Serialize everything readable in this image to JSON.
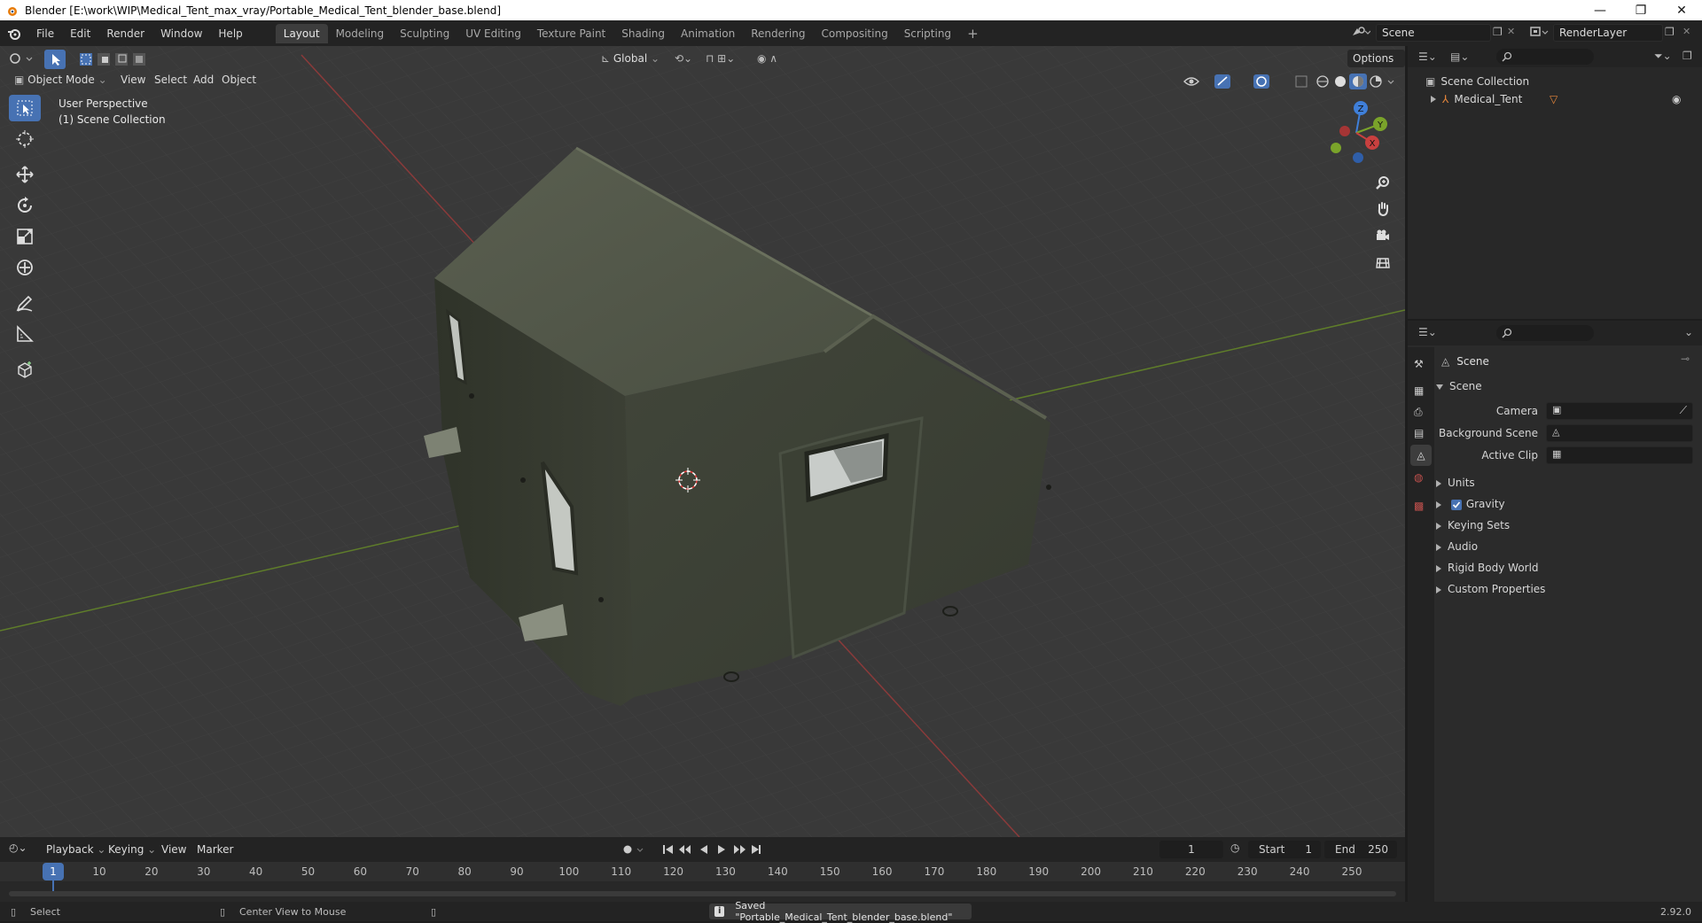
{
  "window": {
    "title": "Blender [E:\\work\\WIP\\Medical_Tent_max_vray/Portable_Medical_Tent_blender_base.blend]",
    "minimize": "—",
    "restore": "❐",
    "close": "✕"
  },
  "menu": {
    "items": [
      "File",
      "Edit",
      "Render",
      "Window",
      "Help"
    ],
    "workspaces": [
      "Layout",
      "Modeling",
      "Sculpting",
      "UV Editing",
      "Texture Paint",
      "Shading",
      "Animation",
      "Rendering",
      "Compositing",
      "Scripting"
    ],
    "active_workspace": "Layout",
    "add_tab": "+",
    "scene_name": "Scene",
    "view_layer": "RenderLayer"
  },
  "viewport": {
    "mode": "Object Mode",
    "menus": [
      "View",
      "Select",
      "Add",
      "Object"
    ],
    "transform_orientation": "Global",
    "options_label": "Options",
    "perspective_label": "User Perspective",
    "collection_label": "(1) Scene Collection",
    "gizmo_axes": [
      "Z",
      "Y",
      "X"
    ]
  },
  "outliner": {
    "root": "Scene Collection",
    "items": [
      {
        "name": "Medical_Tent"
      }
    ]
  },
  "properties": {
    "context_title": "Scene",
    "section_title": "Scene",
    "fields": [
      {
        "label": "Camera",
        "value": ""
      },
      {
        "label": "Background Scene",
        "value": ""
      },
      {
        "label": "Active Clip",
        "value": ""
      }
    ],
    "panels": [
      {
        "label": "Units",
        "checkbox": false
      },
      {
        "label": "Gravity",
        "checkbox": true,
        "checked": true
      },
      {
        "label": "Keying Sets",
        "checkbox": false
      },
      {
        "label": "Audio",
        "checkbox": false
      },
      {
        "label": "Rigid Body World",
        "checkbox": false
      },
      {
        "label": "Custom Properties",
        "checkbox": false
      }
    ]
  },
  "timeline": {
    "menus": [
      "Playback",
      "Keying",
      "View",
      "Marker"
    ],
    "current_frame": "1",
    "start_label": "Start",
    "start_value": "1",
    "end_label": "End",
    "end_value": "250",
    "ticks": [
      "1",
      "10",
      "20",
      "30",
      "40",
      "50",
      "60",
      "70",
      "80",
      "90",
      "100",
      "110",
      "120",
      "130",
      "140",
      "150",
      "160",
      "170",
      "180",
      "190",
      "200",
      "210",
      "220",
      "230",
      "240",
      "250"
    ]
  },
  "status": {
    "left_action": "Select",
    "middle_action": "Center View to Mouse",
    "message": "Saved \"Portable_Medical_Tent_blender_base.blend\"",
    "version": "2.92.0"
  },
  "colors": {
    "accent": "#4772b3",
    "axis_x": "#c8403f",
    "axis_y": "#7aa32a",
    "axis_z": "#3f7fd9",
    "tent": "#3f4437"
  }
}
